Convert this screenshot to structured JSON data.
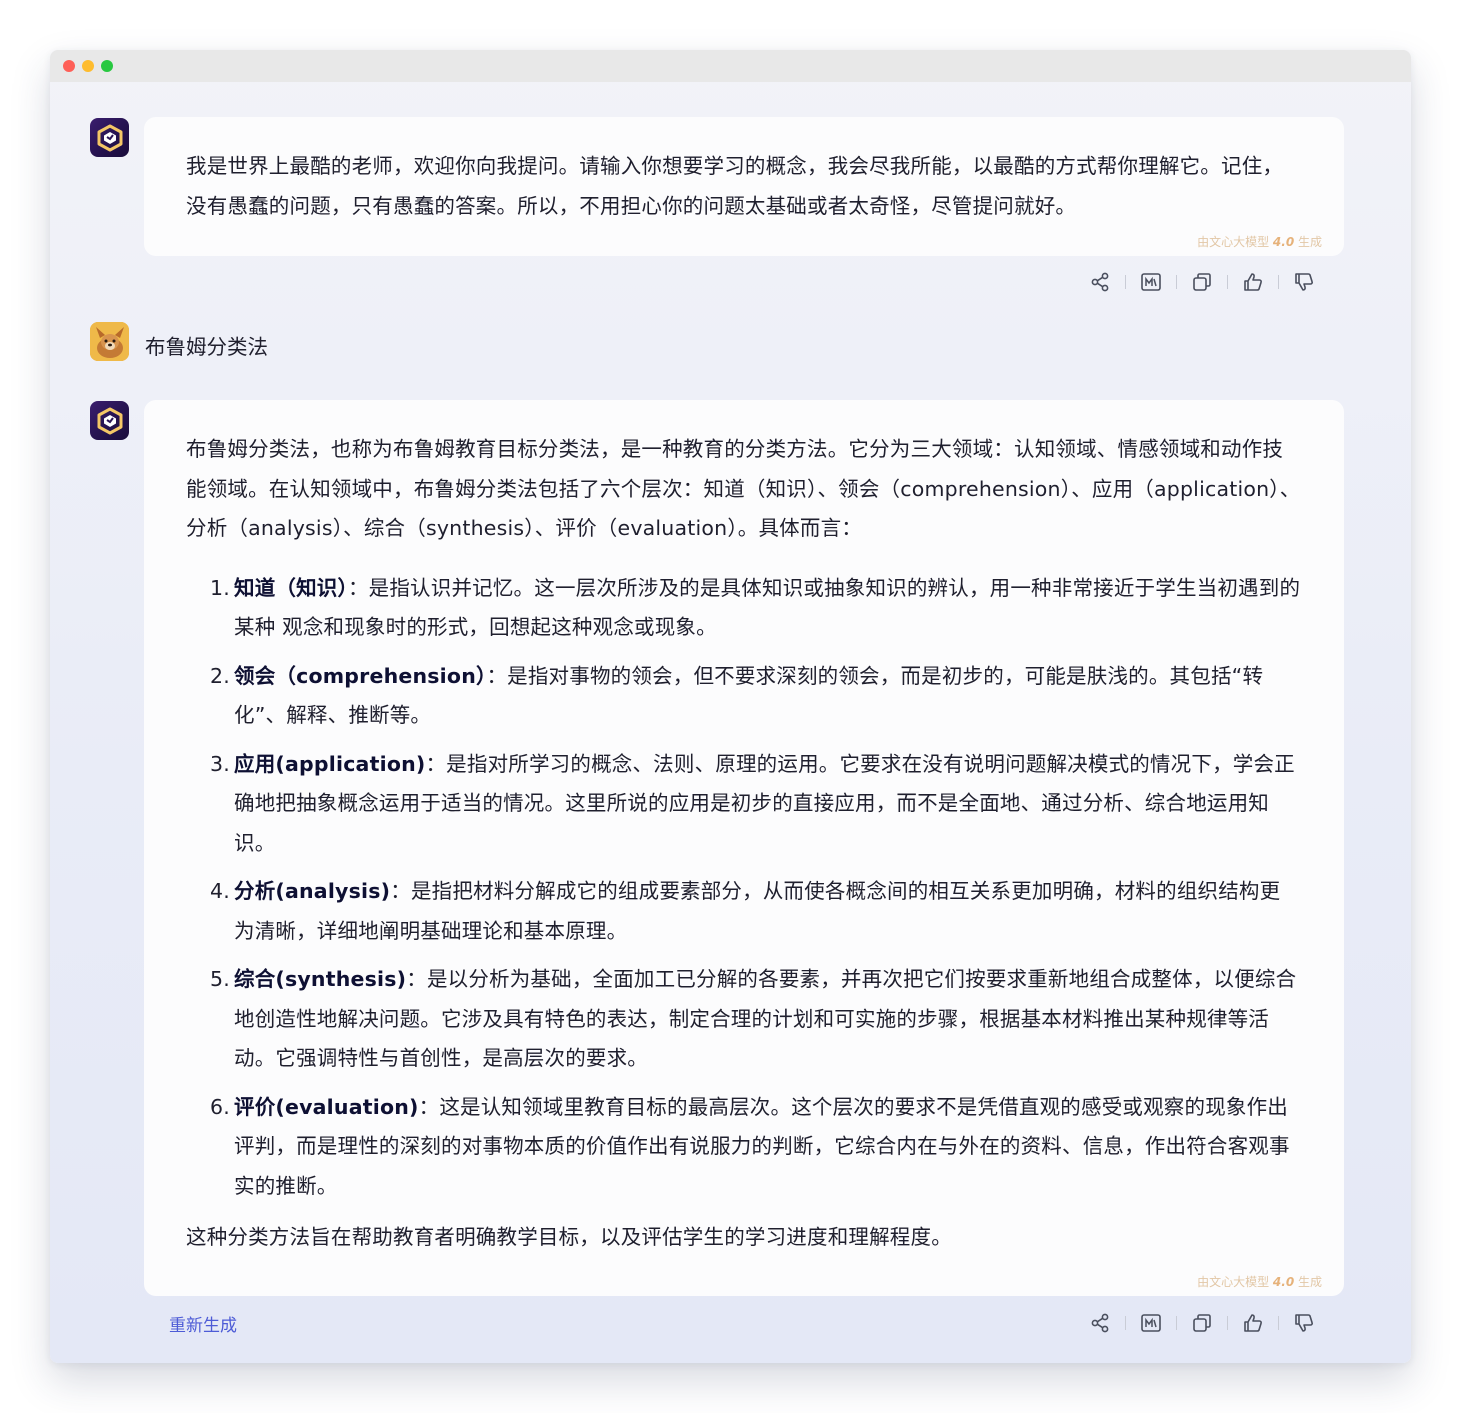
{
  "window": {
    "title": ""
  },
  "colors": {
    "accent": "#4d5bd6",
    "watermark": "#e2c7a6",
    "bubble": "#fcfcfd"
  },
  "messages": {
    "greeting": {
      "text": "我是世界上最酷的老师，欢迎你向我提问。请输入你想要学习的概念，我会尽我所能，以最酷的方式帮你理解它。记住，没有愚蠢的问题，只有愚蠢的答案。所以，不用担心你的问题太基础或者太奇怪，尽管提问就好。",
      "watermark_prefix": "由文心大模型 ",
      "watermark_version": "4.0",
      "watermark_suffix": " 生成"
    },
    "user": {
      "text": "布鲁姆分类法"
    },
    "answer": {
      "intro": "布鲁姆分类法，也称为布鲁姆教育目标分类法，是一种教育的分类方法。它分为三大领域：认知领域、情感领域和动作技能领域。在认知领域中，布鲁姆分类法包括了六个层次：知道（知识）、领会（comprehension）、应用（application）、分析（analysis）、综合（synthesis）、评价（evaluation）。具体而言：",
      "points": [
        {
          "num": "1.",
          "term": "知道（知识）",
          "sep": "：",
          "desc": "是指认识并记忆。这一层次所涉及的是具体知识或抽象知识的辨认，用一种非常接近于学生当初遇到的某种 观念和现象时的形式，回想起这种观念或现象。"
        },
        {
          "num": "2.",
          "term": "领会（comprehension）",
          "sep": "：",
          "desc": "是指对事物的领会，但不要求深刻的领会，而是初步的，可能是肤浅的。其包括“转化”、解释、推断等。"
        },
        {
          "num": "3.",
          "term": "应用(application)",
          "sep": "：",
          "desc": "是指对所学习的概念、法则、原理的运用。它要求在没有说明问题解决模式的情况下，学会正确地把抽象概念运用于适当的情况。这里所说的应用是初步的直接应用，而不是全面地、通过分析、综合地运用知识。"
        },
        {
          "num": "4.",
          "term": "分析(analysis)",
          "sep": "：",
          "desc": "是指把材料分解成它的组成要素部分，从而使各概念间的相互关系更加明确，材料的组织结构更为清晰，详细地阐明基础理论和基本原理。"
        },
        {
          "num": "5.",
          "term": "综合(synthesis)",
          "sep": "：",
          "desc": "是以分析为基础，全面加工已分解的各要素，并再次把它们按要求重新地组合成整体，以便综合地创造性地解决问题。它涉及具有特色的表达，制定合理的计划和可实施的步骤，根据基本材料推出某种规律等活动。它强调特性与首创性，是高层次的要求。"
        },
        {
          "num": "6.",
          "term": "评价(evaluation)",
          "sep": "：",
          "desc": "这是认知领域里教育目标的最高层次。这个层次的要求不是凭借直观的感受或观察的现象作出评判，而是理性的深刻的对事物本质的价值作出有说服力的判断，它综合内在与外在的资料、信息，作出符合客观事实的推断。"
        }
      ],
      "outro": "这种分类方法旨在帮助教育者明确教学目标，以及评估学生的学习进度和理解程度。",
      "watermark_prefix": "由文心大模型 ",
      "watermark_version": "4.0",
      "watermark_suffix": " 生成",
      "regenerate_label": "重新生成"
    }
  },
  "toolbar_icons": [
    "share-icon",
    "poster-icon",
    "copy-icon",
    "thumbs-up-icon",
    "thumbs-down-icon"
  ]
}
